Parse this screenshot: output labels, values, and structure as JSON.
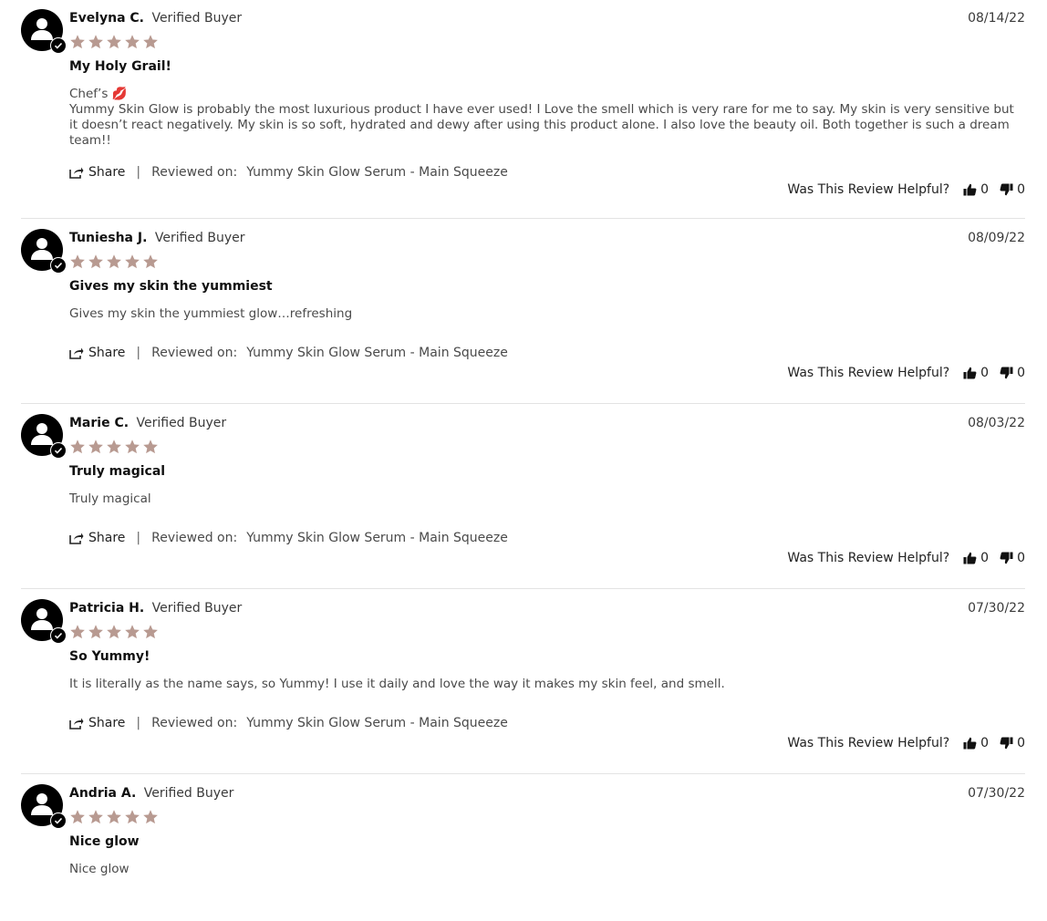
{
  "reviews": [
    {
      "author": "Evelyna C.",
      "badge": "Verified Buyer",
      "date": "08/14/22",
      "rating": 5,
      "title": "My Holy Grail!",
      "body_lines": [
        "Chef’s 💋",
        "Yummy Skin Glow is probably the most luxurious product I have ever used! I Love the smell which is very rare for me to say. My skin is very sensitive but it doesn’t react negatively. My skin is so soft, hydrated and dewy after using this product alone. I also love the beauty oil. Both together is such a dream team!!"
      ],
      "share_label": "Share",
      "reviewed_on_label": "Reviewed on:",
      "product": "Yummy Skin Glow Serum - Main Squeeze",
      "helpful_label": "Was This Review Helpful?",
      "helpful_yes": "0",
      "helpful_no": "0"
    },
    {
      "author": "Tuniesha J.",
      "badge": "Verified Buyer",
      "date": "08/09/22",
      "rating": 5,
      "title": "Gives my skin the yummiest",
      "body_lines": [
        "Gives my skin the yummiest glow…refreshing"
      ],
      "share_label": "Share",
      "reviewed_on_label": "Reviewed on:",
      "product": "Yummy Skin Glow Serum - Main Squeeze",
      "helpful_label": "Was This Review Helpful?",
      "helpful_yes": "0",
      "helpful_no": "0"
    },
    {
      "author": "Marie C.",
      "badge": "Verified Buyer",
      "date": "08/03/22",
      "rating": 5,
      "title": "Truly magical",
      "body_lines": [
        "Truly magical"
      ],
      "share_label": "Share",
      "reviewed_on_label": "Reviewed on:",
      "product": "Yummy Skin Glow Serum - Main Squeeze",
      "helpful_label": "Was This Review Helpful?",
      "helpful_yes": "0",
      "helpful_no": "0"
    },
    {
      "author": "Patricia H.",
      "badge": "Verified Buyer",
      "date": "07/30/22",
      "rating": 5,
      "title": "So Yummy!",
      "body_lines": [
        "It is literally as the name says, so Yummy! I use it daily and love the way it makes my skin feel, and smell."
      ],
      "share_label": "Share",
      "reviewed_on_label": "Reviewed on:",
      "product": "Yummy Skin Glow Serum - Main Squeeze",
      "helpful_label": "Was This Review Helpful?",
      "helpful_yes": "0",
      "helpful_no": "0"
    },
    {
      "author": "Andria A.",
      "badge": "Verified Buyer",
      "date": "07/30/22",
      "rating": 5,
      "title": "Nice glow",
      "body_lines": [
        "Nice glow"
      ]
    }
  ],
  "colors": {
    "star": "#b89a91",
    "text": "#3a3a3a",
    "divider": "#e3e3e3"
  },
  "icons": {
    "avatar": "user-silhouette-icon",
    "verified": "check-circle-icon",
    "star": "star-icon",
    "share": "share-icon",
    "thumbs_up": "thumbs-up-icon",
    "thumbs_down": "thumbs-down-icon"
  }
}
